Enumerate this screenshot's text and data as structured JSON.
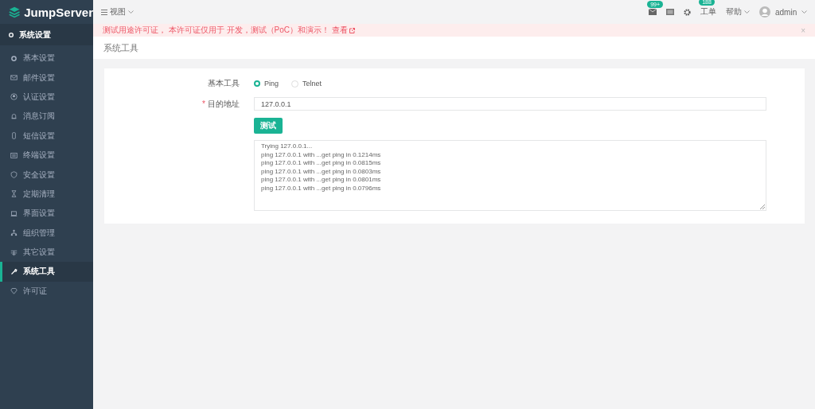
{
  "brand": {
    "name": "JumpServer"
  },
  "sidebar": {
    "section": "系统设置",
    "items": [
      {
        "label": "基本设置",
        "selected": false
      },
      {
        "label": "邮件设置",
        "selected": false
      },
      {
        "label": "认证设置",
        "selected": false
      },
      {
        "label": "消息订阅",
        "selected": false
      },
      {
        "label": "短信设置",
        "selected": false
      },
      {
        "label": "终端设置",
        "selected": false
      },
      {
        "label": "安全设置",
        "selected": false
      },
      {
        "label": "定期清理",
        "selected": false
      },
      {
        "label": "界面设置",
        "selected": false
      },
      {
        "label": "组织管理",
        "selected": false
      },
      {
        "label": "其它设置",
        "selected": false
      },
      {
        "label": "系统工具",
        "selected": true
      },
      {
        "label": "许可证",
        "selected": false
      }
    ]
  },
  "topbar": {
    "view_menu": "视图",
    "mail_badge": "99+",
    "tickets": {
      "label": "工单",
      "badge": "188"
    },
    "help": "帮助",
    "user": "admin"
  },
  "alert": {
    "text": "测试用途许可证， 本许可证仅用于 开发，测试（PoC）和演示！",
    "link": "查看",
    "close": "×"
  },
  "page": {
    "title": "系统工具"
  },
  "form": {
    "tool_label": "基本工具",
    "tools": [
      {
        "label": "Ping",
        "selected": true
      },
      {
        "label": "Telnet",
        "selected": false
      }
    ],
    "address": {
      "required_mark": "*",
      "label": "目的地址",
      "value": "127.0.0.1"
    },
    "submit": "测试",
    "output": [
      "Trying 127.0.0.1...",
      "ping 127.0.0.1 with ...get ping in 0.1214ms",
      "ping 127.0.0.1 with ...get ping in 0.0815ms",
      "ping 127.0.0.1 with ...get ping in 0.0803ms",
      "ping 127.0.0.1 with ...get ping in 0.0801ms",
      "ping 127.0.0.1 with ...get ping in 0.0796ms"
    ]
  }
}
